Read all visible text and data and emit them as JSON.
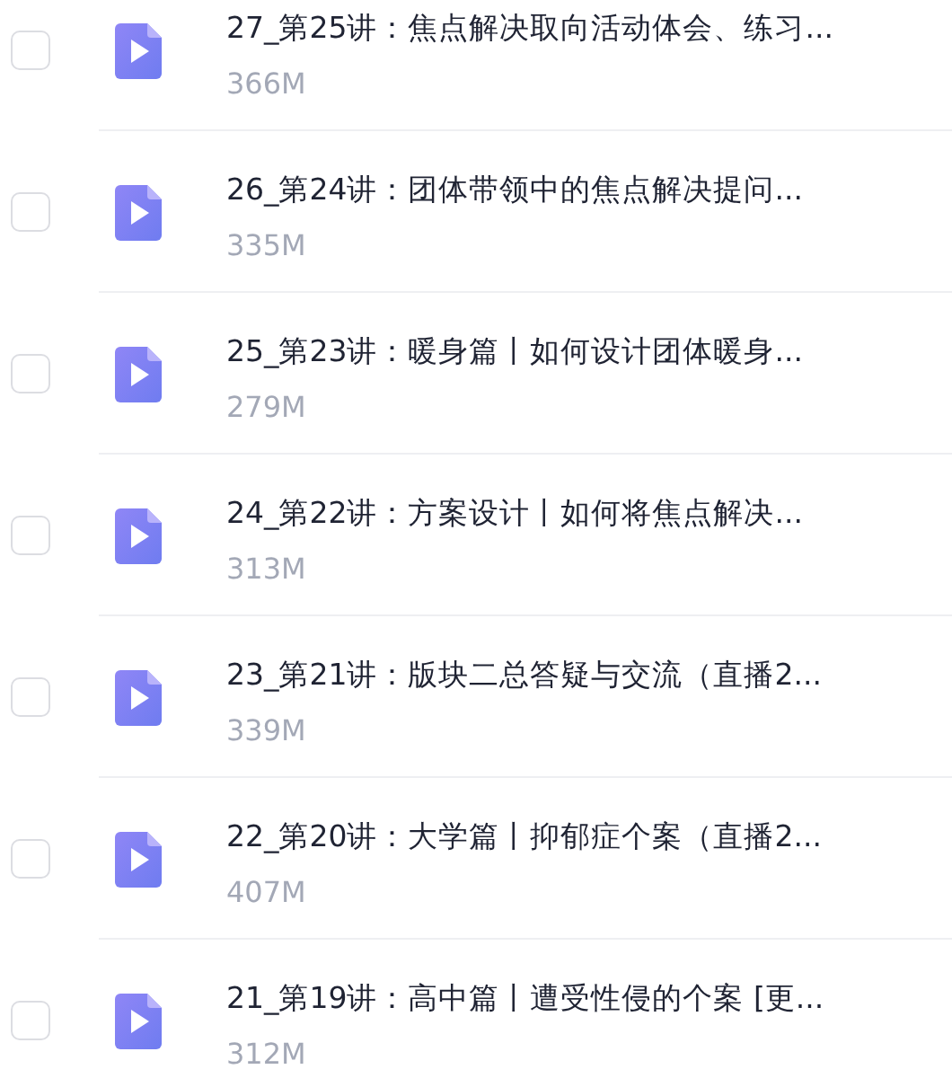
{
  "files": [
    {
      "title": "27_第25讲：焦点解决取向活动体会、练习...",
      "size": "366M",
      "checked": false
    },
    {
      "title": "26_第24讲：团体带领中的焦点解决提问...",
      "size": "335M",
      "checked": false
    },
    {
      "title": "25_第23讲：暖身篇丨如何设计团体暖身...",
      "size": "279M",
      "checked": false
    },
    {
      "title": "24_第22讲：方案设计丨如何将焦点解决...",
      "size": "313M",
      "checked": false
    },
    {
      "title": "23_第21讲：版块二总答疑与交流（直播2...",
      "size": "339M",
      "checked": false
    },
    {
      "title": "22_第20讲：大学篇丨抑郁症个案（直播2...",
      "size": "407M",
      "checked": false
    },
    {
      "title": "21_第19讲：高中篇丨遭受性侵的个案 [更...",
      "size": "312M",
      "checked": false
    }
  ]
}
